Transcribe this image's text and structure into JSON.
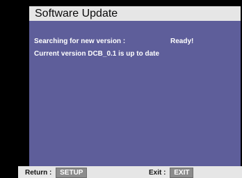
{
  "window": {
    "title": "Software Update"
  },
  "content": {
    "search_label": "Searching for new version :",
    "search_status": "Ready!",
    "current_version_message": "Current version DCB_0.1 is up to date"
  },
  "footer": {
    "return_label": "Return :",
    "return_key": "SETUP",
    "exit_label": "Exit :",
    "exit_key": "EXIT"
  },
  "colors": {
    "background": "#000000",
    "title_bar": "#e6e6e6",
    "panel": "#5e5e9a",
    "text": "#ffffff",
    "key_button": "#8c8c8c"
  }
}
